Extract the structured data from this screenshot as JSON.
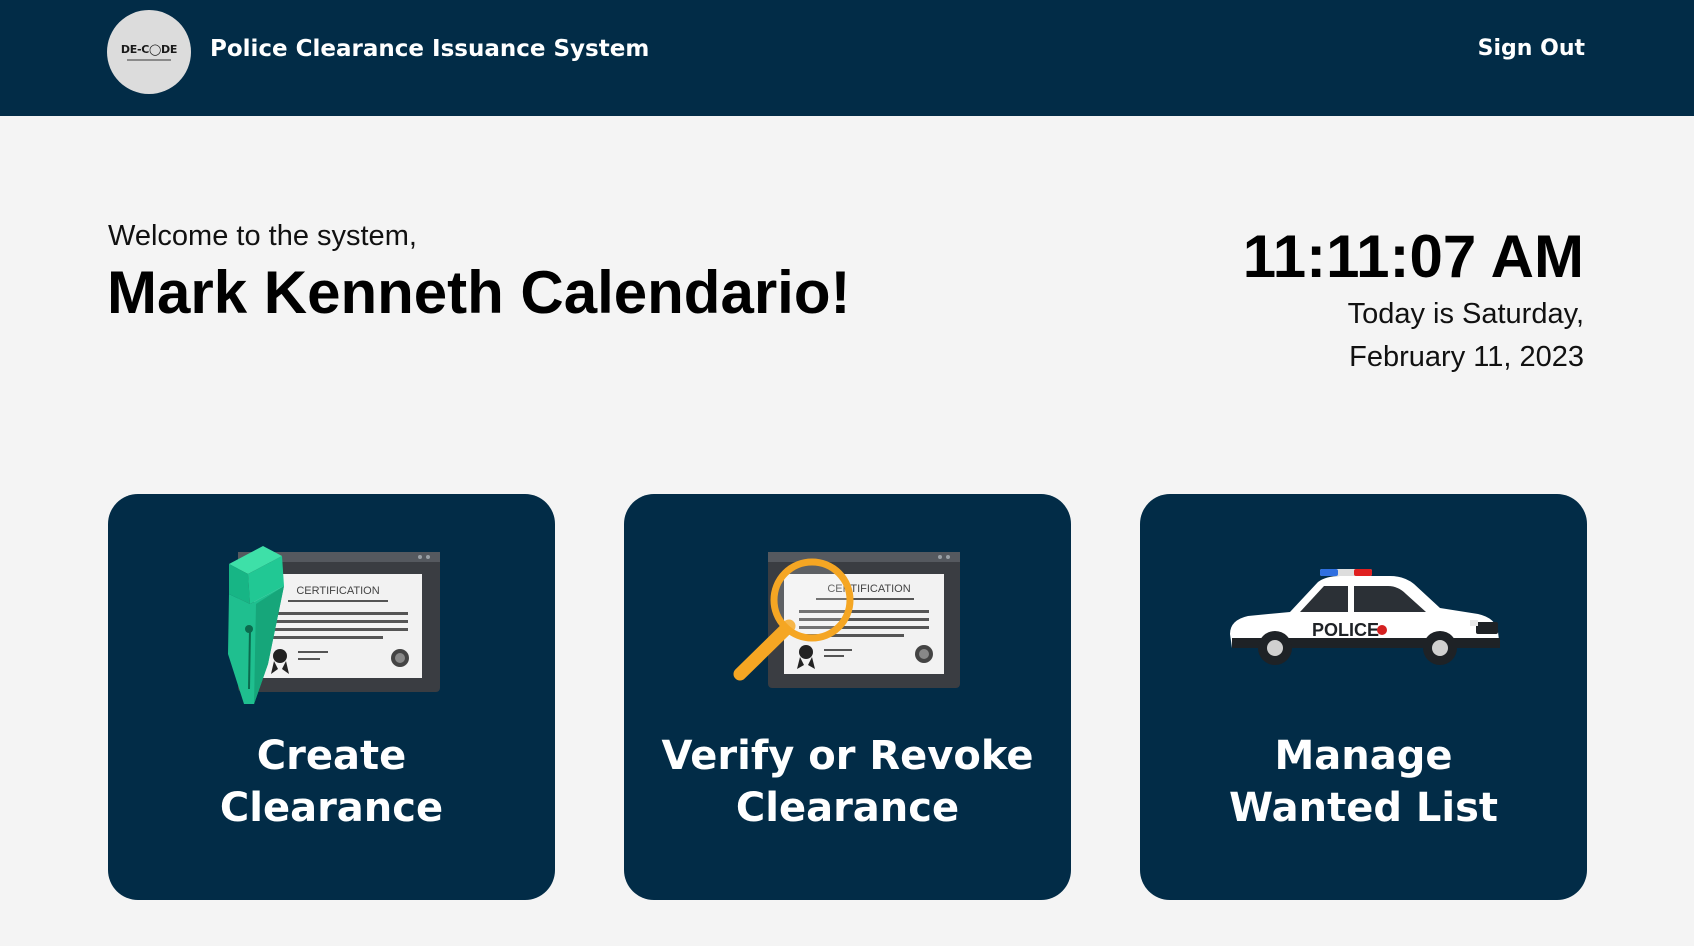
{
  "header": {
    "logo_text": "DE-C◯DE",
    "title": "Police Clearance Issuance System",
    "sign_out_label": "Sign Out"
  },
  "welcome": {
    "greeting": "Welcome to the system,",
    "user_name": "Mark Kenneth Calendario!"
  },
  "clock": {
    "time": "11:11:07 AM",
    "date_line1": "Today is Saturday,",
    "date_line2": "February 11, 2023"
  },
  "cards": [
    {
      "line1": "Create",
      "line2": "Clearance",
      "icon": "certificate-pen-icon",
      "certificate_text": "CERTIFICATION"
    },
    {
      "line1": "Verify or Revoke",
      "line2": "Clearance",
      "icon": "certificate-magnifier-icon",
      "certificate_text": "CERTIFICATION"
    },
    {
      "line1": "Manage",
      "line2": "Wanted List",
      "icon": "police-car-icon",
      "car_text": "POLICE"
    }
  ],
  "colors": {
    "header_bg": "#022c47",
    "card_bg": "#022c47",
    "page_bg": "#f4f4f4",
    "pen_green": "#1fbf8f",
    "magnifier_orange": "#f5a623"
  }
}
